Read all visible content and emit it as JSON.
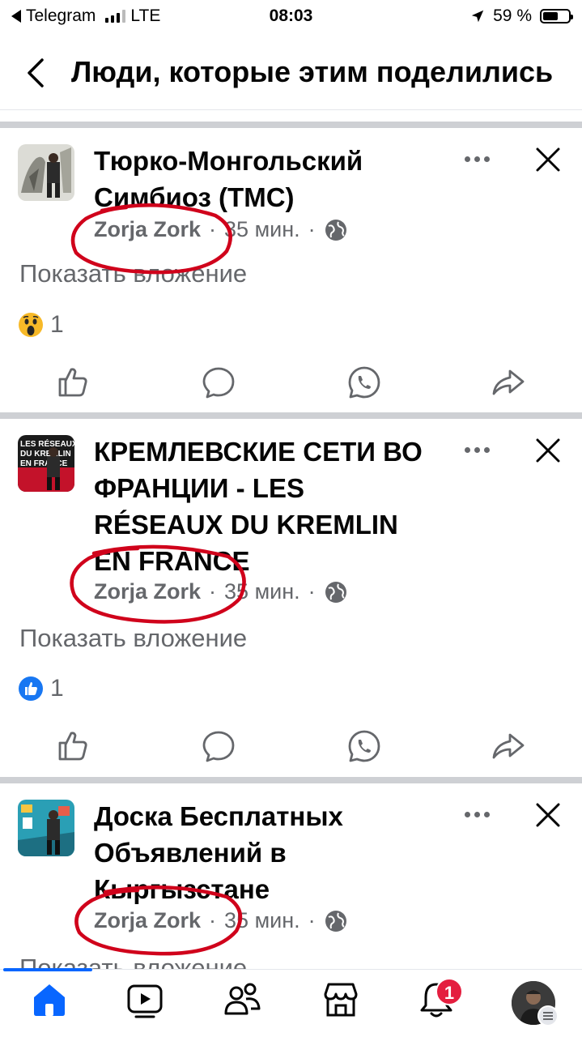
{
  "status_bar": {
    "back_app": "Telegram",
    "network": "LTE",
    "time": "08:03",
    "battery_percent": "59 %",
    "battery_level": 0.59
  },
  "header": {
    "back_icon": "chevron-left-icon",
    "title": "Люди, которые этим поделились"
  },
  "posts": [
    {
      "title": "Тюрко-Монгольский Симбиоз (ТМС)",
      "author": "Zorja Zork",
      "time": "35 мин.",
      "separator": "·",
      "attachment_label": "Показать вложение",
      "reaction_icon": "wow-emoji-icon",
      "reaction_count": "1"
    },
    {
      "title": "КРЕМЛЕВСКИЕ СЕТИ ВО ФРАНЦИИ - LES RÉSEAUX DU KREMLIN EN FRANCE",
      "author": "Zorja Zork",
      "time": "35 мин.",
      "separator": "·",
      "attachment_label": "Показать вложение",
      "reaction_icon": "like-icon",
      "reaction_count": "1"
    },
    {
      "title": "Доска Бесплатных Объявлений в Кыргызстане",
      "author": "Zorja Zork",
      "time": "35 мин.",
      "separator": "·",
      "attachment_label": "Показать вложение"
    }
  ],
  "action_icons": [
    "like-icon",
    "comment-icon",
    "whatsapp-icon",
    "share-icon"
  ],
  "bottom_nav": {
    "items": [
      "home-icon",
      "video-icon",
      "friends-icon",
      "marketplace-icon",
      "notifications-icon",
      "profile-menu"
    ],
    "notification_badge": "1"
  },
  "colors": {
    "accent": "#0866ff",
    "secondary_text": "#65676b",
    "badge": "#e41e3f",
    "annotation_circle": "#d0021b",
    "divider": "#ced0d4"
  }
}
